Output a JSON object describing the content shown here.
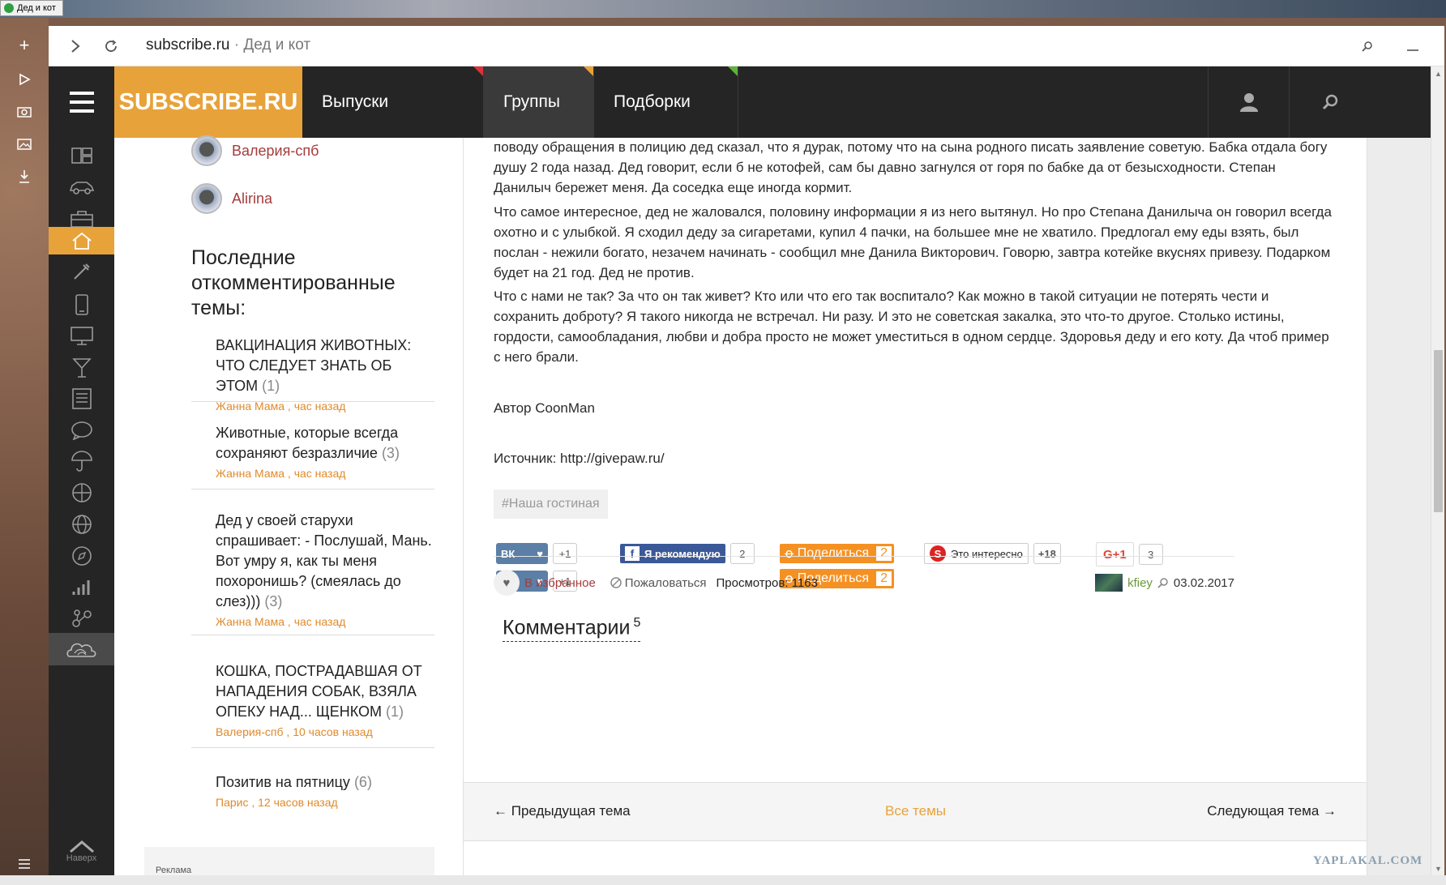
{
  "window": {
    "title": "Дед и кот"
  },
  "browser": {
    "domain": "subscribe.ru",
    "separator": "·",
    "page_title": "Дед и кот"
  },
  "site": {
    "logo": "SUBSCRIBE.RU",
    "menu": [
      {
        "label": "Выпуски",
        "accent": "#d9343a"
      },
      {
        "label": "Группы",
        "accent": "#e8a23a"
      },
      {
        "label": "Подборки",
        "accent": "#5fb33a"
      }
    ],
    "to_top": "Наверх"
  },
  "sidebar": {
    "users": [
      "Валерия-спб",
      "Alirina"
    ],
    "section_title": "Последние откомментированные темы:",
    "topics": [
      {
        "title": "ВАКЦИНАЦИЯ ЖИВОТНЫХ: ЧТО СЛЕДУЕТ ЗНАТЬ ОБ ЭТОМ",
        "count": "(1)",
        "meta": "Жанна Мама , час назад"
      },
      {
        "title": "Животные, которые всегда сохраняют безразличие",
        "count": "(3)",
        "meta": "Жанна Мама , час назад"
      },
      {
        "title": "Дед у своей старухи спрашивает: - Послушай, Мань. Вот умру я, как ты меня похоронишь? (смеялась до слез)))",
        "count": "(3)",
        "meta": "Жанна Мама , час назад"
      },
      {
        "title": "КОШКА, ПОСТРАДАВШАЯ ОТ НАПАДЕНИЯ СОБАК, ВЗЯЛА ОПЕКУ НАД... ЩЕНКОМ",
        "count": "(1)",
        "meta": "Валерия-спб , 10 часов назад"
      },
      {
        "title": "Позитив на пятницу",
        "count": "(6)",
        "meta": "Парис , 12 часов назад"
      }
    ],
    "ad_label": "Реклама"
  },
  "article": {
    "p1": "поводу обращения в полицию дед сказал, что я дурак, потому что на сына родного писать заявление советую. Бабка отдала богу душу 2 года назад. Дед говорит, если б не котофей, сам бы давно загнулся от горя по бабке да от безысходности. Степан Данилыч бережет меня. Да соседка еще иногда кормит.",
    "p2": "Что самое интересное, дед не жаловался, половину информации я из него вытянул. Но про Степана Данилыча он говорил всегда охотно и с улыбкой. Я сходил деду за сигаретами, купил 4 пачки, на большее мне не хватило. Предлогал ему еды взять, был послан - нежили богато, незачем начинать - сообщил мне Данила Викторович. Говорю, завтра котейке вкуснях привезу. Подарком будет на 21 год. Дед не против.",
    "p3": "Что с нами не так? За что он так живет? Кто или что его так воспитало? Как можно в такой ситуации не потерять чести и сохранить доброту? Я такого никогда не встречал. Ни разу. И это не советская закалка, это что-то другое. Столько истины, гордости, самообладания, любви и добра просто не может уместиться в одном сердце. Здоровья деду и его коту. Да чтоб пример с него брали.",
    "author": "Автор CoonMan",
    "source": "Источник: http://givepaw.ru/",
    "hashtag": "#Наша гостиная",
    "social": {
      "vk_label": "ВК",
      "vk_count1": "+1",
      "vk_count2": "+1",
      "fb_label": "Я рекомендую",
      "fb_count": "2",
      "ok_label": "Поделиться",
      "ok_count1": "2",
      "ok_count2": "2",
      "surf_label": "Это интересно",
      "surf_count": "+18",
      "gplus_label": "G+1",
      "gplus_count": "3"
    },
    "actions": {
      "favorite": "В избранное",
      "complain": "Пожаловаться",
      "views": "Просмотров: 1163",
      "author": "kfiey",
      "date": "03.02.2017"
    },
    "comments_title": "Комментарии",
    "comments_count": "5",
    "nav": {
      "prev": "← Предыдущая тема",
      "all": "Все темы",
      "next": "Следующая тема →"
    }
  },
  "watermark": "YAPLAKAL.COM"
}
